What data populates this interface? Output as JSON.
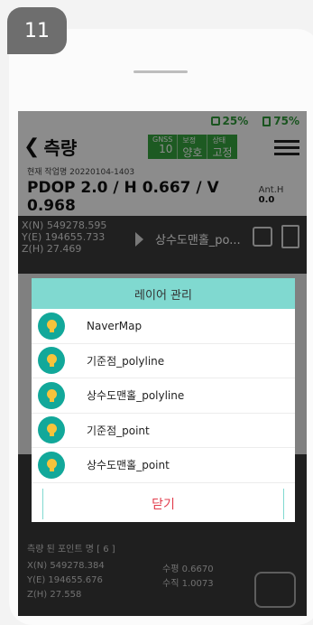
{
  "step_number": "11",
  "status": {
    "gps_percent": "25%",
    "battery_percent": "75%"
  },
  "appbar": {
    "back_label": "측량",
    "gnss_cells": [
      {
        "label": "GNSS",
        "value": "10"
      },
      {
        "label": "보정",
        "value": "양호"
      },
      {
        "label": "상태",
        "value": "고정"
      }
    ]
  },
  "job": {
    "line": "현재 작업명 20220104-1403"
  },
  "precision": {
    "pdop_text": "PDOP 2.0 / H 0.667 / V 0.968",
    "ant_label": "Ant.H",
    "ant_value": "0.0"
  },
  "position": {
    "x": "X(N) 549278.595",
    "y": "Y(E) 194655.733",
    "z": "Z(H) 27.469"
  },
  "current_layer": "상수도맨홀_po...",
  "measured": {
    "title": "측량 된 포인트 명 [ 6 ]",
    "x": "X(N) 549278.384",
    "y": "Y(E) 194655.676",
    "z": "Z(H) 27.558",
    "horizontal": "수평 0.6670",
    "vertical": "수직 1.0073"
  },
  "dialog": {
    "title": "레이어 관리",
    "layers": [
      {
        "label": "NaverMap"
      },
      {
        "label": "기준점_polyline"
      },
      {
        "label": "상수도맨홀_polyline"
      },
      {
        "label": "기준점_point"
      },
      {
        "label": "상수도맨홀_point"
      }
    ],
    "close_label": "닫기"
  },
  "colors": {
    "accent": "#80d9d0",
    "icon_bg": "#12a89a",
    "close_text": "#e23c4c",
    "status_green": "#36a53e"
  }
}
